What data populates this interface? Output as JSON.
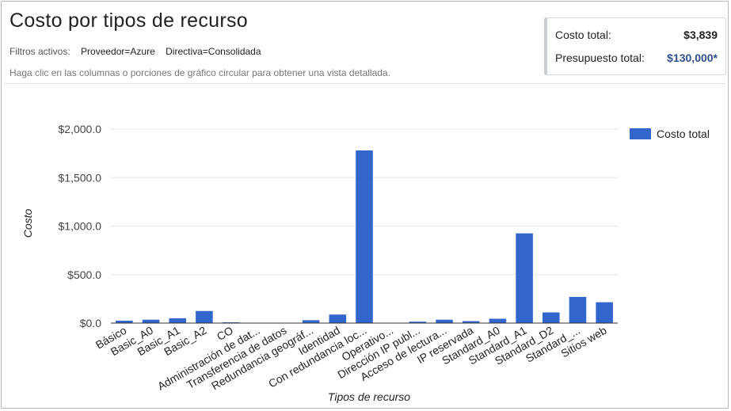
{
  "header": {
    "title": "Costo por tipos de recurso",
    "filters_label": "Filtros activos:",
    "filters": [
      "Proveedor=Azure",
      "Directiva=Consolidada"
    ],
    "hint": "Haga clic en las columnas o porciones de gráfico circular para obtener una vista detallada."
  },
  "summary": {
    "total_cost_label": "Costo total:",
    "total_cost_value": "$3,839",
    "budget_label": "Presupuesto total:",
    "budget_value": "$130,000*"
  },
  "colors": {
    "bar": "#3366cc",
    "budget": "#2e4e8f",
    "grid": "#e6e6e6"
  },
  "chart_data": {
    "type": "bar",
    "xlabel": "Tipos de recurso",
    "ylabel": "Costo",
    "ylim": [
      0,
      2000
    ],
    "yticks": [
      0,
      500,
      1000,
      1500,
      2000
    ],
    "ytick_labels": [
      "$0.0",
      "$500.0",
      "$1,000.0",
      "$1,500.0",
      "$2,000.0"
    ],
    "legend_position": "right",
    "grid": true,
    "categories": [
      "Básico",
      "Basic_A0",
      "Basic_A1",
      "Basic_A2",
      "CO",
      "Administración de dat...",
      "Transferencia de datos",
      "Redundancia geográf...",
      "Identidad",
      "Con redundancia loc...",
      "Operativo...",
      "Dirección IP publ...",
      "Acceso de lectura...",
      "IP reservada",
      "Standard_A0",
      "Standard_A1",
      "Standard_D2",
      "Standard_...",
      "Sitios web"
    ],
    "series": [
      {
        "name": "Costo total",
        "values": [
          25,
          35,
          50,
          125,
          8,
          2,
          1,
          30,
          88,
          1780,
          3,
          15,
          35,
          20,
          45,
          925,
          110,
          270,
          215
        ]
      }
    ]
  }
}
